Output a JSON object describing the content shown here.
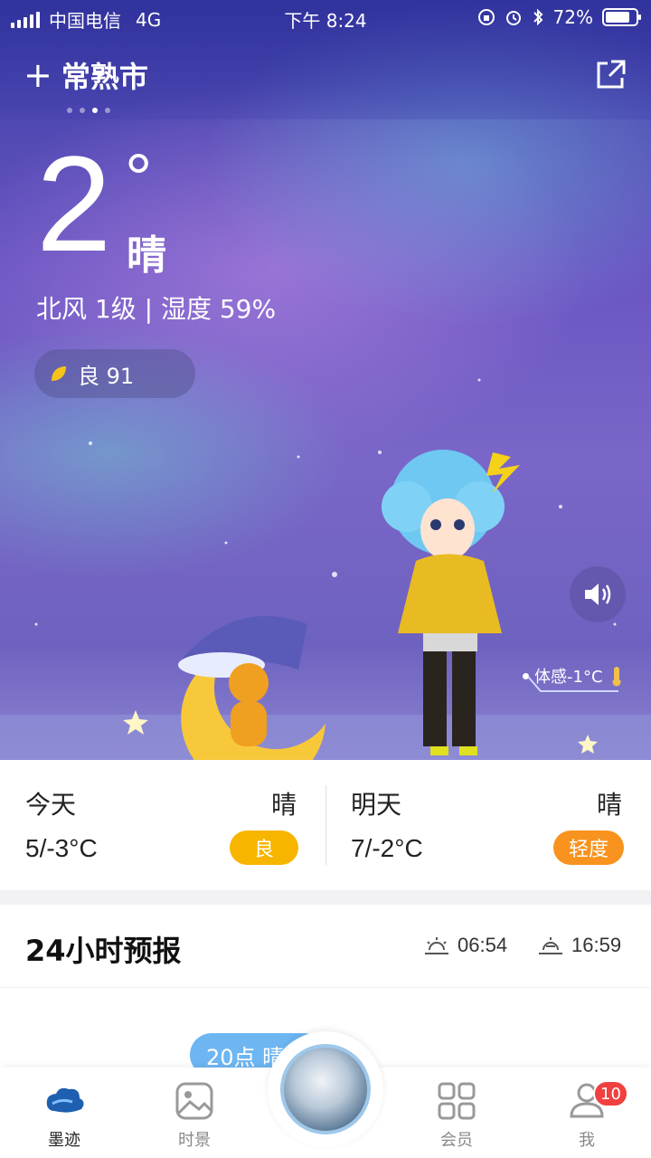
{
  "status_bar": {
    "carrier": "中国电信",
    "network": "4G",
    "time": "下午 8:24",
    "battery": "72%",
    "battery_level": 0.72
  },
  "header": {
    "add_icon": "plus-icon",
    "city": "常熟市",
    "share_icon": "share-icon",
    "page_count": 4,
    "active_page": 3
  },
  "current": {
    "temperature": "2",
    "degree_symbol": "°",
    "condition": "晴",
    "wind_humidity": "北风 1级 | 湿度 59%",
    "aqi": "良 91",
    "feels_like": "体感-1°C"
  },
  "days": [
    {
      "label": "今天",
      "condition": "晴",
      "range": "5/-3°C",
      "aqi": "良",
      "aqi_color": "#f7b500"
    },
    {
      "label": "明天",
      "condition": "晴",
      "range": "7/-2°C",
      "aqi": "轻度",
      "aqi_color": "#f7931e"
    }
  ],
  "forecast24": {
    "title": "24小时预报",
    "sunrise": "06:54",
    "sunset": "16:59",
    "bubble": "20点 晴"
  },
  "tabbar": {
    "tabs": [
      {
        "label": "墨迹",
        "icon": "cloud-logo-icon",
        "active": true
      },
      {
        "label": "时景",
        "icon": "picture-icon",
        "active": false
      },
      {
        "label": "会员",
        "icon": "grid-icon",
        "active": false
      },
      {
        "label": "我",
        "icon": "user-icon",
        "active": false
      }
    ],
    "notification_count": "10"
  }
}
